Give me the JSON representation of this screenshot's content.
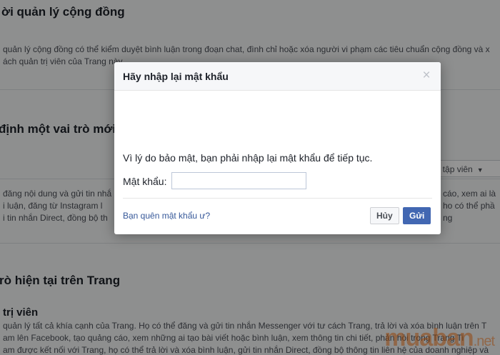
{
  "background": {
    "section1_title": "ời quản lý cộng đồng",
    "section1_lines": [
      "quản lý cộng đồng có thể kiểm duyệt bình luận trong đoạn chat, đình chỉ hoặc xóa người vi phạm các tiêu chuẩn cộng đồng và x",
      "ách quản trị viên của Trang này."
    ],
    "section2_title": "định một vai trò mới",
    "role_select_label": "ên tập viên",
    "section2_lines": [
      "đăng nội dung và gửi tin nhắ",
      "i luận, đăng từ Instagram l",
      "i tin nhắn Direct, đồng bộ th"
    ],
    "section2_lines_right": [
      "cáo, xem ai là",
      "ho có thể phầ",
      "ng"
    ],
    "section3_title": "rò hiện tại trên Trang",
    "section3_subtitle": "trị viên",
    "section3_lines": [
      "quản lý tất cả khía cạnh của Trang. Họ có thể đăng và gửi tin nhắn Messenger với tư cách Trang, trả lời và xóa bình luận trên T",
      "am lên Facebook, tạo quảng cáo, xem những ai tạo bài viết hoặc bình luận, xem thông tin chi tiết, phản hồi trong Trang Ti",
      "am được kết nối với Trang, họ có thể trả lời và xóa bình luận, gửi tin nhắn Direct, đồng bộ thông tin liên hệ của doanh nghiệp và"
    ],
    "watermark_main": "muaban",
    "watermark_suffix": ".net"
  },
  "dialog": {
    "title": "Hãy nhập lại mật khẩu",
    "close_glyph": "×",
    "message": "Vì lý do bảo mật, bạn phải nhập lại mật khẩu để tiếp tục.",
    "password_label": "Mật khẩu:",
    "password_value": "",
    "forgot_link": "Bạn quên mật khẩu ư?",
    "cancel_label": "Hủy",
    "submit_label": "Gửi"
  },
  "colors": {
    "primary": "#4267b2",
    "link": "#365899",
    "overlay": "rgba(0,0,0,0.42)"
  }
}
